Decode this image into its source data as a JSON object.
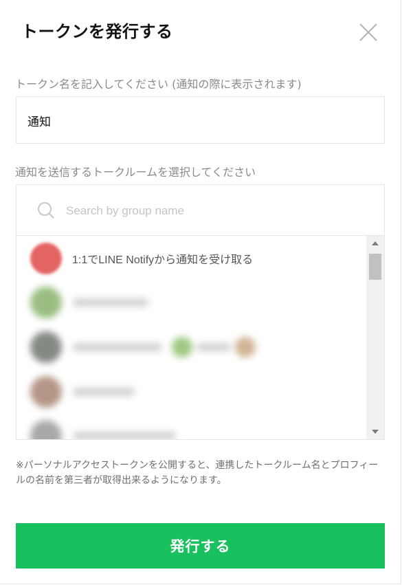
{
  "dialog": {
    "title": "トークンを発行する",
    "close_icon": "close-icon"
  },
  "token_name": {
    "label": "トークン名を記入してください (通知の際に表示されます)",
    "value": "通知"
  },
  "room_select": {
    "label": "通知を送信するトークルームを選択してください",
    "search_placeholder": "Search by group name",
    "search_icon": "search-icon",
    "items": [
      {
        "label": "1:1でLINE Notifyから通知を受け取る",
        "avatar_color": "#e04a4a",
        "blurred": false
      },
      {
        "label": "",
        "avatar_color": "#88b26a",
        "blurred": true
      },
      {
        "label": "",
        "avatar_color": "#6f756e",
        "blurred": true
      },
      {
        "label": "",
        "avatar_color": "#a88472",
        "blurred": true
      },
      {
        "label": "",
        "avatar_color": "#9a9a9a",
        "blurred": true
      }
    ]
  },
  "notice": {
    "text": "※パーソナルアクセストークンを公開すると、連携したトークルーム名とプロフィールの名前を第三者が取得出来るようになります。"
  },
  "actions": {
    "issue_label": "発行する",
    "issue_color": "#19c15e"
  }
}
